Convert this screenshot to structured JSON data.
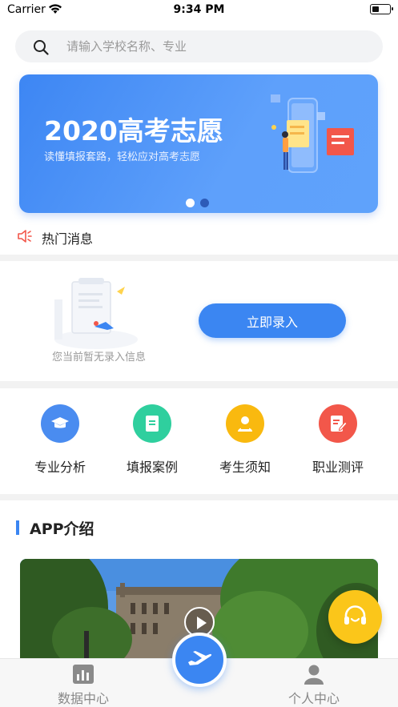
{
  "status_bar": {
    "carrier": "Carrier",
    "time": "9:34 PM"
  },
  "search": {
    "placeholder": "请输入学校名称、专业"
  },
  "banner": {
    "title": "2020高考志愿",
    "subtitle": "读懂填报套路，轻松应对高考志愿",
    "page_count": 2,
    "active_index": 0
  },
  "news": {
    "label": "热门消息"
  },
  "record": {
    "empty_text": "您当前暂无录入信息",
    "button_label": "立即录入"
  },
  "grid": {
    "items": [
      {
        "label": "专业分析",
        "icon": "graduation-cap-icon",
        "color": "#4a8cf0"
      },
      {
        "label": "填报案例",
        "icon": "document-icon",
        "color": "#2fcf9e"
      },
      {
        "label": "考生须知",
        "icon": "student-icon",
        "color": "#f9b90f"
      },
      {
        "label": "职业测评",
        "icon": "edit-form-icon",
        "color": "#f2574a"
      }
    ]
  },
  "intro": {
    "title": "APP介绍"
  },
  "tabbar": {
    "items": [
      {
        "label": "数据中心",
        "icon": "chart-icon"
      },
      {
        "label": "",
        "icon": "airplane-icon"
      },
      {
        "label": "个人中心",
        "icon": "person-icon"
      }
    ]
  },
  "colors": {
    "primary": "#3b86f2",
    "support": "#fbc61a"
  }
}
